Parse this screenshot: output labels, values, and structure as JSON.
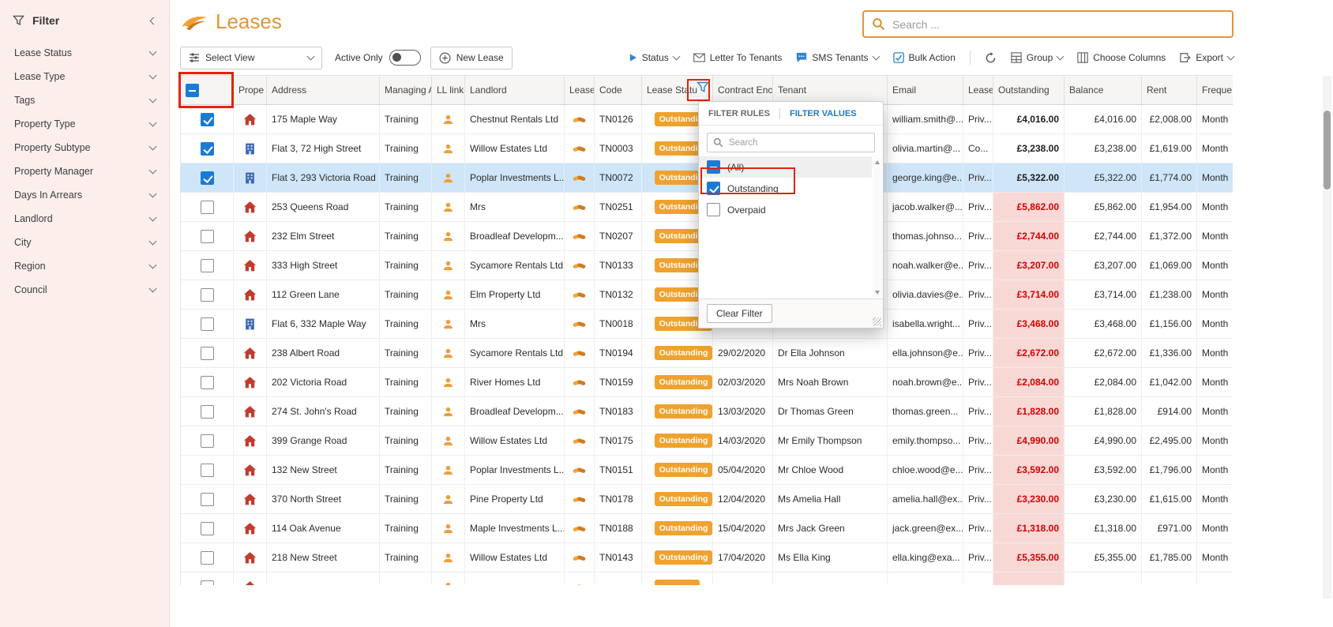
{
  "colors": {
    "accent_orange": "#e2953b",
    "badge_orange": "#f0a22e",
    "selected_row_blue": "#cfe6f9",
    "arrears_bg": "#f9d9d6",
    "arrears_text": "#d40000",
    "annotation_red": "#e3230e",
    "checkbox_blue": "#1a7bd6",
    "active_tab_blue": "#1e78d0"
  },
  "sidebar": {
    "title": "Filter",
    "items": [
      {
        "label": "Lease Status"
      },
      {
        "label": "Lease Type"
      },
      {
        "label": "Tags"
      },
      {
        "label": "Property Type"
      },
      {
        "label": "Property Subtype"
      },
      {
        "label": "Property Manager"
      },
      {
        "label": "Days In Arrears"
      },
      {
        "label": "Landlord"
      },
      {
        "label": "City"
      },
      {
        "label": "Region"
      },
      {
        "label": "Council"
      }
    ]
  },
  "topbar": {
    "title": "Leases",
    "search_placeholder": "Search ..."
  },
  "toolbar": {
    "select_view": "Select View",
    "active_only_label": "Active Only",
    "new_lease": "New Lease",
    "status": "Status",
    "letter_to_tenants": "Letter To Tenants",
    "sms_tenants": "SMS Tenants",
    "bulk_action": "Bulk Action",
    "group": "Group",
    "choose_columns": "Choose Columns",
    "export": "Export"
  },
  "table": {
    "headers": {
      "property": "Prope",
      "address": "Address",
      "managing": "Managing A",
      "ll_link": "LL link",
      "landlord": "Landlord",
      "lease": "Lease",
      "code": "Code",
      "lease_status": "Lease Statu",
      "contract_end": "Contract Enc",
      "tenant": "Tenant",
      "email": "Email",
      "lease_type": "Lease",
      "outstanding": "Outstanding",
      "balance": "Balance",
      "rent": "Rent",
      "frequency": "Freque"
    },
    "rows": [
      {
        "checked": true,
        "selected": false,
        "property_type": "house",
        "address": "175 Maple Way",
        "managing": "Training",
        "landlord": "Chestnut Rentals Ltd",
        "code": "TN0126",
        "status": "Outstanding",
        "contract_end": "",
        "tenant": "",
        "email": "william.smith@...",
        "lease_type": "Priv...",
        "outstanding": "£4,016.00",
        "balance": "£4,016.00",
        "rent": "£2,008.00",
        "frequency": "Month",
        "arrears": false
      },
      {
        "checked": true,
        "selected": false,
        "property_type": "flat",
        "address": "Flat 3, 72 High Street",
        "managing": "Training",
        "landlord": "Willow Estates Ltd",
        "code": "TN0003",
        "status": "Outstanding",
        "contract_end": "",
        "tenant": "",
        "email": "olivia.martin@...",
        "lease_type": "Co...",
        "outstanding": "£3,238.00",
        "balance": "£3,238.00",
        "rent": "£1,619.00",
        "frequency": "Month",
        "arrears": false
      },
      {
        "checked": true,
        "selected": true,
        "property_type": "flat",
        "address": "Flat 3, 293 Victoria Road",
        "managing": "Training",
        "landlord": "Poplar Investments L...",
        "code": "TN0072",
        "status": "Outstanding",
        "contract_end": "",
        "tenant": "",
        "email": "george.king@e...",
        "lease_type": "Priv...",
        "outstanding": "£5,322.00",
        "balance": "£5,322.00",
        "rent": "£1,774.00",
        "frequency": "Month",
        "arrears": false
      },
      {
        "checked": false,
        "selected": false,
        "property_type": "house",
        "address": "253 Queens Road",
        "managing": "Training",
        "landlord": "Mrs",
        "code": "TN0251",
        "status": "Outstanding",
        "contract_end": "",
        "tenant": "",
        "email": "jacob.walker@...",
        "lease_type": "Priv...",
        "outstanding": "£5,862.00",
        "balance": "£5,862.00",
        "rent": "£1,954.00",
        "frequency": "Month",
        "arrears": true
      },
      {
        "checked": false,
        "selected": false,
        "property_type": "house",
        "address": "232 Elm Street",
        "managing": "Training",
        "landlord": "Broadleaf Developm...",
        "code": "TN0207",
        "status": "Outstanding",
        "contract_end": "",
        "tenant": "",
        "email": "thomas.johnso...",
        "lease_type": "Priv...",
        "outstanding": "£2,744.00",
        "balance": "£2,744.00",
        "rent": "£1,372.00",
        "frequency": "Month",
        "arrears": true
      },
      {
        "checked": false,
        "selected": false,
        "property_type": "house",
        "address": "333 High Street",
        "managing": "Training",
        "landlord": "Sycamore Rentals Ltd",
        "code": "TN0133",
        "status": "Outstanding",
        "contract_end": "",
        "tenant": "",
        "email": "noah.walker@e...",
        "lease_type": "Priv...",
        "outstanding": "£3,207.00",
        "balance": "£3,207.00",
        "rent": "£1,069.00",
        "frequency": "Month",
        "arrears": true
      },
      {
        "checked": false,
        "selected": false,
        "property_type": "house",
        "address": "112 Green Lane",
        "managing": "Training",
        "landlord": "Elm Property Ltd",
        "code": "TN0132",
        "status": "Outstanding",
        "contract_end": "",
        "tenant": "",
        "email": "olivia.davies@e...",
        "lease_type": "Priv...",
        "outstanding": "£3,714.00",
        "balance": "£3,714.00",
        "rent": "£1,238.00",
        "frequency": "Month",
        "arrears": true
      },
      {
        "checked": false,
        "selected": false,
        "property_type": "flat",
        "address": "Flat 6, 332 Maple Way",
        "managing": "Training",
        "landlord": "Mrs",
        "code": "TN0018",
        "status": "Outstanding",
        "contract_end": "",
        "tenant": "",
        "email": "isabella.wright...",
        "lease_type": "Priv...",
        "outstanding": "£3,468.00",
        "balance": "£3,468.00",
        "rent": "£1,156.00",
        "frequency": "Month",
        "arrears": true
      },
      {
        "checked": false,
        "selected": false,
        "property_type": "house",
        "address": "238 Albert Road",
        "managing": "Training",
        "landlord": "Sycamore Rentals Ltd",
        "code": "TN0194",
        "status": "Outstanding",
        "contract_end": "29/02/2020",
        "tenant": "Dr Ella Johnson",
        "email": "ella.johnson@e...",
        "lease_type": "Priv...",
        "outstanding": "£2,672.00",
        "balance": "£2,672.00",
        "rent": "£1,336.00",
        "frequency": "Month",
        "arrears": true
      },
      {
        "checked": false,
        "selected": false,
        "property_type": "house",
        "address": "202 Victoria Road",
        "managing": "Training",
        "landlord": "River Homes Ltd",
        "code": "TN0159",
        "status": "Outstanding",
        "contract_end": "02/03/2020",
        "tenant": "Mrs Noah Brown",
        "email": "noah.brown@e...",
        "lease_type": "Priv...",
        "outstanding": "£2,084.00",
        "balance": "£2,084.00",
        "rent": "£1,042.00",
        "frequency": "Month",
        "arrears": true
      },
      {
        "checked": false,
        "selected": false,
        "property_type": "house",
        "address": "274 St. John's Road",
        "managing": "Training",
        "landlord": "Broadleaf Developm...",
        "code": "TN0183",
        "status": "Outstanding",
        "contract_end": "13/03/2020",
        "tenant": "Dr Thomas Green",
        "email": "thomas.green...",
        "lease_type": "Priv...",
        "outstanding": "£1,828.00",
        "balance": "£1,828.00",
        "rent": "£914.00",
        "frequency": "Month",
        "arrears": true
      },
      {
        "checked": false,
        "selected": false,
        "property_type": "house",
        "address": "399 Grange Road",
        "managing": "Training",
        "landlord": "Willow Estates Ltd",
        "code": "TN0175",
        "status": "Outstanding",
        "contract_end": "14/03/2020",
        "tenant": "Mr Emily Thompson",
        "email": "emily.thompso...",
        "lease_type": "Priv...",
        "outstanding": "£4,990.00",
        "balance": "£4,990.00",
        "rent": "£2,495.00",
        "frequency": "Month",
        "arrears": true
      },
      {
        "checked": false,
        "selected": false,
        "property_type": "house",
        "address": "132 New Street",
        "managing": "Training",
        "landlord": "Poplar Investments L...",
        "code": "TN0151",
        "status": "Outstanding",
        "contract_end": "05/04/2020",
        "tenant": "Mr Chloe Wood",
        "email": "chloe.wood@e...",
        "lease_type": "Priv...",
        "outstanding": "£3,592.00",
        "balance": "£3,592.00",
        "rent": "£1,796.00",
        "frequency": "Month",
        "arrears": true
      },
      {
        "checked": false,
        "selected": false,
        "property_type": "house",
        "address": "370 North Street",
        "managing": "Training",
        "landlord": "Pine Property Ltd",
        "code": "TN0178",
        "status": "Outstanding",
        "contract_end": "12/04/2020",
        "tenant": "Ms Amelia Hall",
        "email": "amelia.hall@ex...",
        "lease_type": "Priv...",
        "outstanding": "£3,230.00",
        "balance": "£3,230.00",
        "rent": "£1,615.00",
        "frequency": "Month",
        "arrears": true
      },
      {
        "checked": false,
        "selected": false,
        "property_type": "house",
        "address": "114 Oak Avenue",
        "managing": "Training",
        "landlord": "Maple Investments L...",
        "code": "TN0188",
        "status": "Outstanding",
        "contract_end": "15/04/2020",
        "tenant": "Mrs Jack Green",
        "email": "jack.green@ex...",
        "lease_type": "Priv...",
        "outstanding": "£1,318.00",
        "balance": "£1,318.00",
        "rent": "£971.00",
        "frequency": "Month",
        "arrears": true
      },
      {
        "checked": false,
        "selected": false,
        "property_type": "house",
        "address": "218 New Street",
        "managing": "Training",
        "landlord": "Willow Estates Ltd",
        "code": "TN0143",
        "status": "Outstanding",
        "contract_end": "17/04/2020",
        "tenant": "Ms Ella King",
        "email": "ella.king@exa...",
        "lease_type": "Priv...",
        "outstanding": "£5,355.00",
        "balance": "£5,355.00",
        "rent": "£1,785.00",
        "frequency": "Month",
        "arrears": true
      },
      {
        "checked": false,
        "selected": false,
        "property_type": "house",
        "address": "",
        "managing": "",
        "landlord": "",
        "code": "",
        "status": "",
        "contract_end": "",
        "tenant": "",
        "email": "",
        "lease_type": "",
        "outstanding": "",
        "balance": "",
        "rent": "",
        "frequency": "",
        "arrears": true
      }
    ]
  },
  "filter_popup": {
    "tab_rules": "FILTER RULES",
    "tab_values": "FILTER VALUES",
    "search_placeholder": "Search",
    "options": [
      {
        "label": "(All)",
        "state": "indeterminate"
      },
      {
        "label": "Outstanding",
        "state": "checked",
        "annotated": true
      },
      {
        "label": "Overpaid",
        "state": "unchecked"
      }
    ],
    "clear_button": "Clear Filter"
  }
}
